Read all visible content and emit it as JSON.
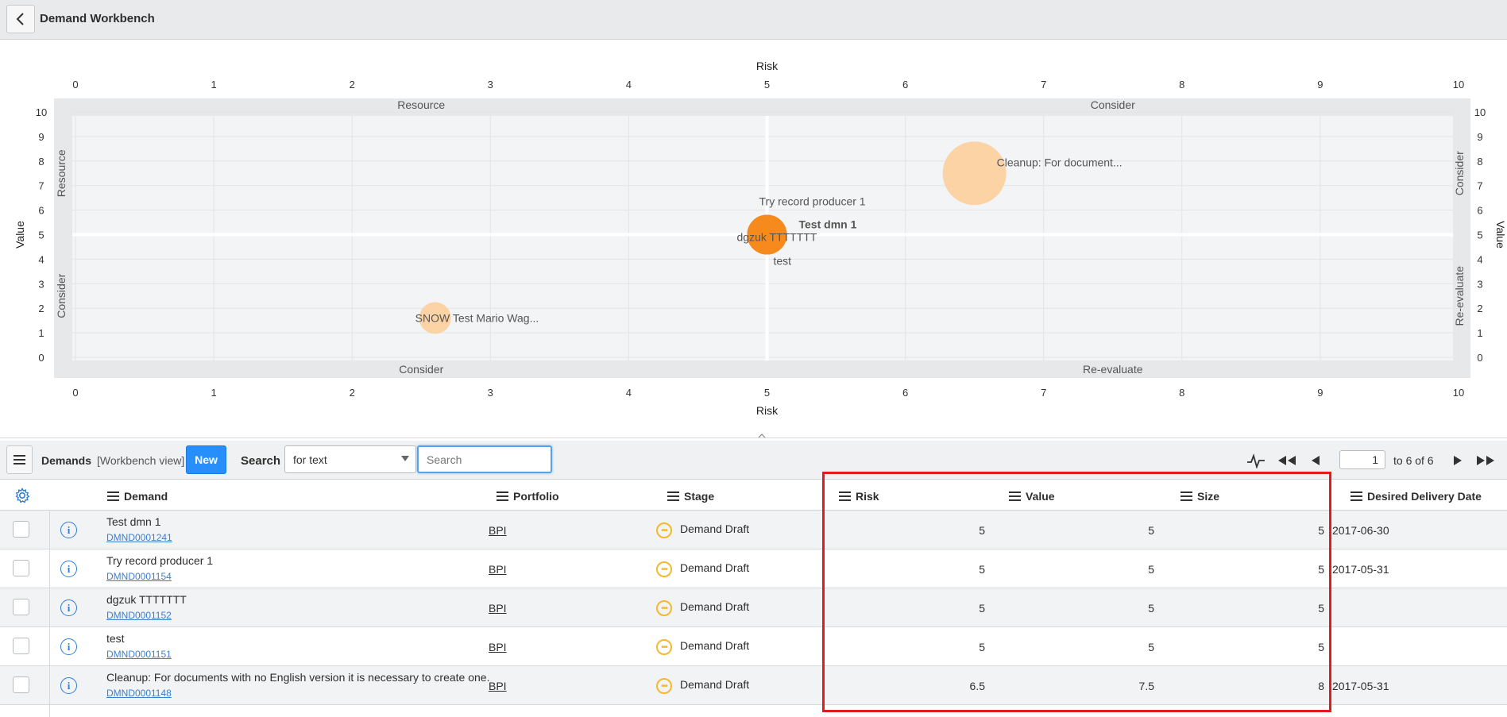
{
  "header": {
    "title": "Demand Workbench",
    "back_icon": "chevron-left-icon"
  },
  "chart_data": {
    "type": "scatter",
    "title": "",
    "xlabel": "Risk",
    "ylabel": "Value",
    "xlim": [
      0,
      10
    ],
    "ylim": [
      0,
      10
    ],
    "x_ticks": [
      "0",
      "1",
      "2",
      "3",
      "4",
      "5",
      "6",
      "7",
      "8",
      "9",
      "10"
    ],
    "y_ticks": [
      "0",
      "1",
      "2",
      "3",
      "4",
      "5",
      "6",
      "7",
      "8",
      "9",
      "10"
    ],
    "grid": true,
    "quadrants": {
      "top_left": "Resource",
      "top_right": "Consider",
      "bottom_left": "Consider",
      "bottom_right": "Re-evaluate",
      "left_top": "Resource",
      "left_bottom": "Consider",
      "right_top": "Consider",
      "right_bottom": "Re-evaluate"
    },
    "points": [
      {
        "label": "Cleanup: For document...",
        "x": 6.5,
        "y": 7.5,
        "size": 8,
        "color": "#fbd3a5"
      },
      {
        "label": "SNOW Test Mario Wag...",
        "x": 2.6,
        "y": 1.6,
        "size": 4,
        "color": "#fbd3a5"
      },
      {
        "label": "Test dmn 1",
        "x": 5,
        "y": 5,
        "size": 5,
        "color": "#f78a1d"
      },
      {
        "label": "Try record producer 1",
        "x": 5,
        "y": 5,
        "size": 5,
        "color": "#f78a1d"
      },
      {
        "label": "dgzuk TTTTTTT",
        "x": 5,
        "y": 5,
        "size": 5,
        "color": "#f78a1d"
      },
      {
        "label": "test",
        "x": 5,
        "y": 5,
        "size": 5,
        "color": "#f78a1d"
      }
    ]
  },
  "list": {
    "menu_icon": "hamburger-icon",
    "title": "Demands",
    "view": "[Workbench view]",
    "new_label": "New",
    "search_label": "Search",
    "search_field": "for text",
    "search_placeholder": "Search",
    "pager": {
      "page": "1",
      "of_text": "to 6 of 6"
    }
  },
  "columns": {
    "settings_icon": "gear-icon",
    "demand": "Demand",
    "portfolio": "Portfolio",
    "stage": "Stage",
    "risk": "Risk",
    "value": "Value",
    "size": "Size",
    "date": "Desired Delivery Date"
  },
  "rows": [
    {
      "name": "Test dmn 1",
      "number": "DMND0001241",
      "portfolio": "BPI",
      "stage": "Demand Draft",
      "risk": "5",
      "value": "5",
      "size": "5",
      "date": "2017-06-30"
    },
    {
      "name": "Try record producer 1",
      "number": "DMND0001154",
      "portfolio": "BPI",
      "stage": "Demand Draft",
      "risk": "5",
      "value": "5",
      "size": "5",
      "date": "2017-05-31"
    },
    {
      "name": "dgzuk TTTTTTT",
      "number": "DMND0001152",
      "portfolio": "BPI",
      "stage": "Demand Draft",
      "risk": "5",
      "value": "5",
      "size": "5",
      "date": ""
    },
    {
      "name": "test",
      "number": "DMND0001151",
      "portfolio": "BPI",
      "stage": "Demand Draft",
      "risk": "5",
      "value": "5",
      "size": "5",
      "date": ""
    },
    {
      "name": "Cleanup: For documents with no English version it is necessary to create one.",
      "number": "DMND0001148",
      "portfolio": "BPI",
      "stage": "Demand Draft",
      "risk": "6.5",
      "value": "7.5",
      "size": "8",
      "date": "2017-05-31"
    }
  ]
}
